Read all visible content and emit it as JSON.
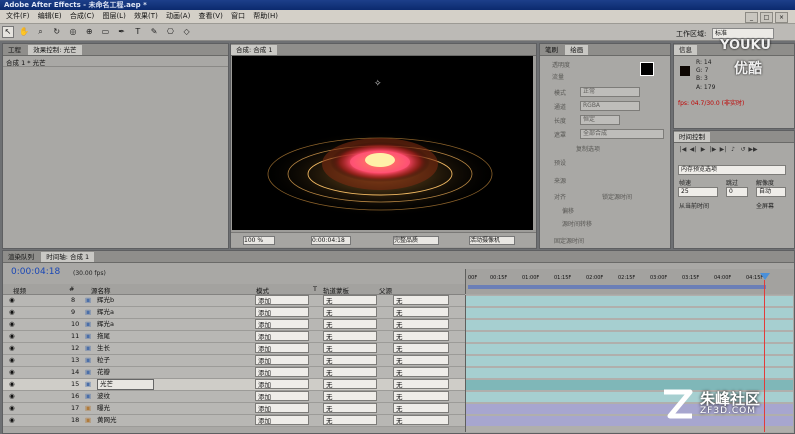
{
  "window": {
    "title": "Adobe After Effects - 未命名工程.aep *"
  },
  "menu": [
    "文件(F)",
    "编辑(E)",
    "合成(C)",
    "图层(L)",
    "效果(T)",
    "动画(A)",
    "查看(V)",
    "窗口",
    "帮助(H)"
  ],
  "workspace": {
    "label": "工作区域:",
    "value": "标准"
  },
  "project_panel": {
    "tabs": [
      "工程",
      "效果控制: 光芒"
    ],
    "subtitle": "合成 1 * 光芒"
  },
  "comp_panel": {
    "tab": "合成: 合成 1",
    "zoom": "100 %",
    "time": "0:00:04:18",
    "quality": "完整品质",
    "camera": "活动摄像机"
  },
  "paint_panel": {
    "tabs": [
      "笔刷",
      "绘画"
    ],
    "labels": [
      "透明度",
      "流量",
      "模式",
      "通道",
      "长度",
      "遮罩",
      "复制选项",
      "预设",
      "来源",
      "对齐",
      "锁定源时间",
      "偏移",
      "源时间转移",
      "固定源时间"
    ],
    "values": [
      "正常",
      "RGBA",
      "恒定",
      "全部合成"
    ]
  },
  "info_panel": {
    "tab": "信息",
    "r": "R: 14",
    "g": "G: 7",
    "b": "B: 3",
    "a": "A: 179",
    "fps": "fps: 04.7/30.0 (非实时)"
  },
  "time_control": {
    "tab": "时间控制",
    "preview_option": "内存预览选项",
    "frame_rate_label": "帧速",
    "skip_label": "跳过",
    "resolution_label": "解像度",
    "frame_rate": "25",
    "skip": "0",
    "resolution": "自动",
    "from_current": "从当前时间",
    "full_screen": "全屏幕"
  },
  "timeline": {
    "tabs": [
      "渲染队列",
      "时间轴: 合成 1"
    ],
    "timecode": "0:00:04:18",
    "fps": "(30.00 fps)",
    "headers": {
      "video": "视频",
      "num": "#",
      "name": "源名称",
      "mode": "模式",
      "t": "T",
      "trkmat": "轨道蒙板",
      "parent": "父源"
    },
    "ruler": [
      "00F",
      "00:15F",
      "01:00F",
      "01:15F",
      "02:00F",
      "02:15F",
      "03:00F",
      "03:15F",
      "04:00F",
      "04:15F"
    ],
    "layers": [
      {
        "num": "8",
        "name": "辉光b",
        "mode": "添加",
        "trkmat": "无",
        "parent": "无"
      },
      {
        "num": "9",
        "name": "辉光a",
        "mode": "添加",
        "trkmat": "无",
        "parent": "无"
      },
      {
        "num": "10",
        "name": "辉光a",
        "mode": "添加",
        "trkmat": "无",
        "parent": "无"
      },
      {
        "num": "11",
        "name": "拖尾",
        "mode": "添加",
        "trkmat": "无",
        "parent": "无"
      },
      {
        "num": "12",
        "name": "生长",
        "mode": "添加",
        "trkmat": "无",
        "parent": "无"
      },
      {
        "num": "13",
        "name": "粒子",
        "mode": "添加",
        "trkmat": "无",
        "parent": "无"
      },
      {
        "num": "14",
        "name": "花瓣",
        "mode": "添加",
        "trkmat": "无",
        "parent": "无"
      },
      {
        "num": "15",
        "name": "光芒",
        "mode": "添加",
        "trkmat": "无",
        "parent": "无"
      },
      {
        "num": "16",
        "name": "波纹",
        "mode": "添加",
        "trkmat": "无",
        "parent": "无"
      },
      {
        "num": "17",
        "name": "曝光",
        "mode": "添加",
        "trkmat": "无",
        "parent": "无"
      },
      {
        "num": "18",
        "name": "黄网光",
        "mode": "添加",
        "trkmat": "无",
        "parent": "无"
      }
    ]
  },
  "watermarks": {
    "youku_en": "YOUKU",
    "youku_cn": "优酷",
    "zf_cn": "朱峰社区",
    "zf_en": "ZF3D.COM"
  },
  "colors": {
    "accent": "#1d3f8a",
    "track": "#a6cfd0",
    "track_alt": "#a7a6cf",
    "cti": "#e23b3b",
    "fps_red": "#c00000"
  }
}
